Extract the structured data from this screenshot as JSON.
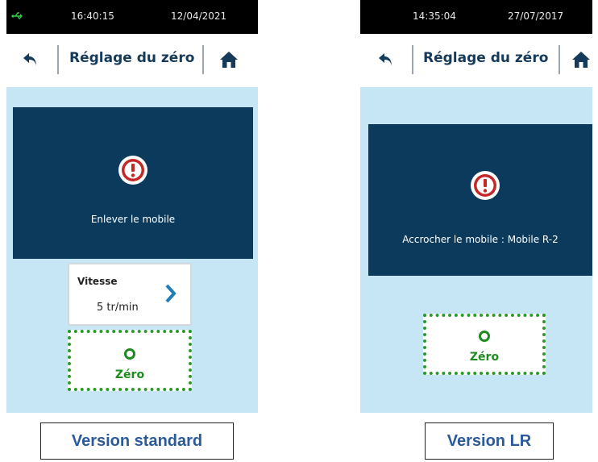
{
  "screens": {
    "standard": {
      "status": {
        "time": "16:40:15",
        "date": "12/04/2021"
      },
      "header": {
        "title": "Réglage du zéro"
      },
      "alert": {
        "message": "Enlever le mobile"
      },
      "speed": {
        "label": "Vitesse",
        "value": "5 tr/min"
      },
      "zero_button": {
        "label": "Zéro"
      },
      "caption": "Version standard"
    },
    "lr": {
      "status": {
        "time": "14:35:04",
        "date": "27/07/2017"
      },
      "header": {
        "title": "Réglage du zéro"
      },
      "alert": {
        "message": "Accrocher le mobile : Mobile R-2"
      },
      "zero_button": {
        "label": "Zéro"
      },
      "caption": "Version LR"
    }
  },
  "icons": {
    "usb": "usb-icon",
    "back": "back-arrow-icon",
    "home": "home-icon",
    "alert": "exclamation-circle-icon",
    "chevron": "chevron-right-icon",
    "zero": "ring-icon"
  },
  "colors": {
    "status_bar": "#000000",
    "header_text": "#153a5a",
    "body_background": "#c7e6f5",
    "alert_panel": "#0b3a5c",
    "alert_icon": "#c62828",
    "zero_green": "#2a9a2a",
    "chevron_blue": "#1e7fb8",
    "caption_text": "#2b5a9c"
  }
}
